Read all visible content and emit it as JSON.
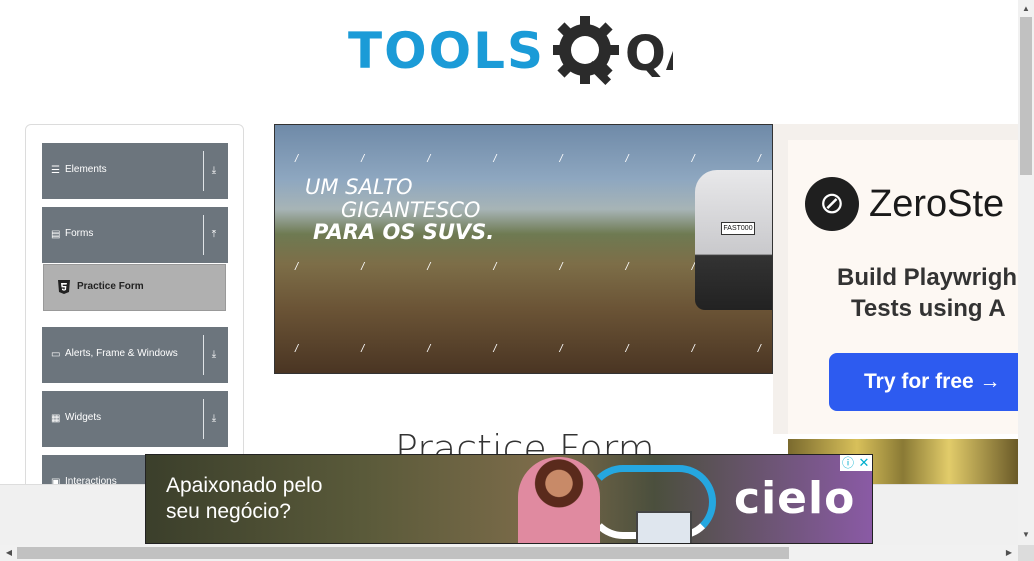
{
  "header": {
    "logo_text_left": "TOOLS",
    "logo_text_right": "QA"
  },
  "sidebar": {
    "groups": [
      {
        "label": "Elements",
        "icon": "hamburger-icon",
        "arrow": "download-arrow-icon",
        "expanded": false
      },
      {
        "label": "Forms",
        "icon": "document-icon",
        "arrow": "upload-arrow-icon",
        "expanded": true
      },
      {
        "label": "Alerts, Frame & Windows",
        "icon": "window-icon",
        "arrow": "download-arrow-icon",
        "expanded": false
      },
      {
        "label": "Widgets",
        "icon": "grid-icon",
        "arrow": "download-arrow-icon",
        "expanded": false
      },
      {
        "label": "Interactions",
        "icon": "interactions-icon",
        "arrow": "download-arrow-icon",
        "expanded": false
      }
    ],
    "active_item": {
      "label": "Practice Form",
      "icon": "html5-icon"
    }
  },
  "main": {
    "page_title": "Practice Form"
  },
  "ads": {
    "banner": {
      "line1": "UM SALTO",
      "line2": "GIGANTESCO",
      "line3": "PARA OS SUVS.",
      "plate": "FAST000"
    },
    "right": {
      "brand": "ZeroSte",
      "tagline1": "Build Playwrigh",
      "tagline2": "Tests using A",
      "cta": "Try for free →"
    },
    "bottom": {
      "line1": "Apaixonado pelo",
      "line2": "seu negócio?",
      "brand": "cielo",
      "info_icon": "ⓘ",
      "close_icon": "✕"
    }
  },
  "colors": {
    "accent_blue": "#1b9bd7",
    "sidebar_group_bg": "#6c757d",
    "active_item_bg": "#b0b0b0",
    "cta_blue": "#2d5bf0"
  }
}
